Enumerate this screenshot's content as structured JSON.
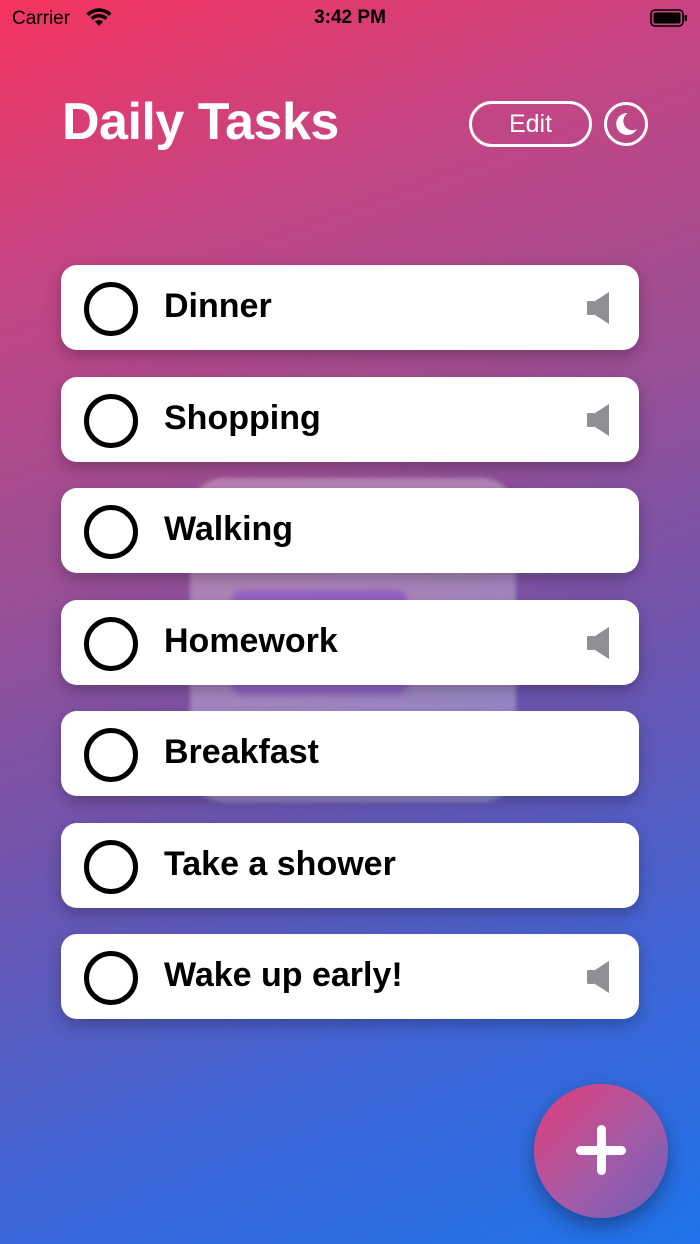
{
  "status_bar": {
    "carrier": "Carrier",
    "time": "3:42 PM"
  },
  "header": {
    "title": "Daily Tasks",
    "edit_label": "Edit"
  },
  "tasks": [
    {
      "label": "Dinner",
      "done": false,
      "has_sound": true
    },
    {
      "label": "Shopping",
      "done": false,
      "has_sound": true
    },
    {
      "label": "Walking",
      "done": false,
      "has_sound": false
    },
    {
      "label": "Homework",
      "done": false,
      "has_sound": true
    },
    {
      "label": "Breakfast",
      "done": false,
      "has_sound": false
    },
    {
      "label": "Take a shower",
      "done": false,
      "has_sound": false
    },
    {
      "label": "Wake up early!",
      "done": false,
      "has_sound": true
    }
  ],
  "icons": {
    "theme_toggle": "moon-icon",
    "add": "plus-icon",
    "reminder": "speaker-icon",
    "checkbox": "circle-icon"
  },
  "colors": {
    "gradient_start": "#f5345e",
    "gradient_end": "#1f73ea",
    "fab_start": "#e23c76",
    "fab_end": "#6a5fbb",
    "speaker": "#8e8e93"
  }
}
